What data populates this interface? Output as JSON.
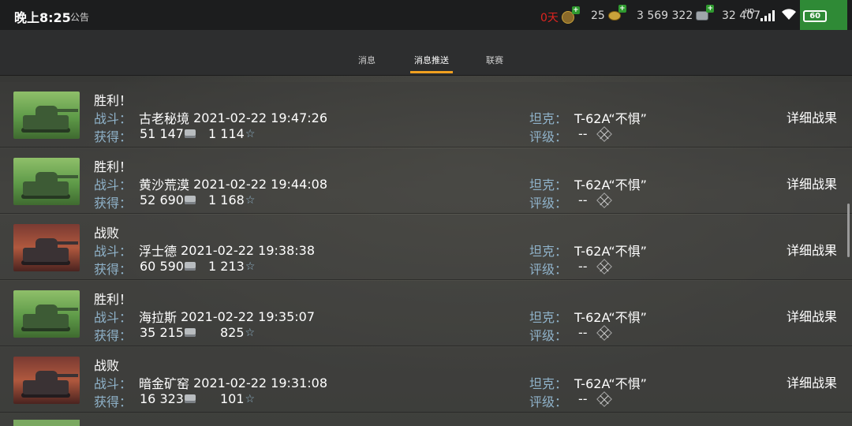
{
  "status_bar": {
    "time": "晚上8:25",
    "notice": "公告",
    "premium_days": "0天",
    "gold": "25",
    "silver": "3 569 322",
    "free_xp": "32 407",
    "network_label": "HD",
    "battery": "60"
  },
  "tabs": [
    {
      "label": "消息",
      "active": false
    },
    {
      "label": "消息推送",
      "active": true
    },
    {
      "label": "联赛",
      "active": false
    }
  ],
  "labels": {
    "battle": "战斗：",
    "earned": "获得：",
    "tank": "坦克：",
    "rating": "评级："
  },
  "battles": [
    {
      "result": "胜利！",
      "outcome": "win",
      "map": "古老秘境",
      "datetime": "2021-02-22 19:47:26",
      "credits": "51 147",
      "xp": "1 114",
      "tank": "T-62A“不惧”",
      "rating": "--",
      "detail": "详细战果"
    },
    {
      "result": "胜利！",
      "outcome": "win",
      "map": "黄沙荒漠",
      "datetime": "2021-02-22 19:44:08",
      "credits": "52 690",
      "xp": "1 168",
      "tank": "T-62A“不惧”",
      "rating": "--",
      "detail": "详细战果"
    },
    {
      "result": "战败",
      "outcome": "lose",
      "map": "浮士德",
      "datetime": "2021-02-22 19:38:38",
      "credits": "60 590",
      "xp": "1 213",
      "tank": "T-62A“不惧”",
      "rating": "--",
      "detail": "详细战果"
    },
    {
      "result": "胜利！",
      "outcome": "win",
      "map": "海拉斯",
      "datetime": "2021-02-22 19:35:07",
      "credits": "35 215",
      "xp": "825",
      "tank": "T-62A“不惧”",
      "rating": "--",
      "detail": "详细战果"
    },
    {
      "result": "战败",
      "outcome": "lose",
      "map": "暗金矿窑",
      "datetime": "2021-02-22 19:31:08",
      "credits": "16 323",
      "xp": "101",
      "tank": "T-62A“不惧”",
      "rating": "--",
      "detail": "详细战果"
    }
  ]
}
